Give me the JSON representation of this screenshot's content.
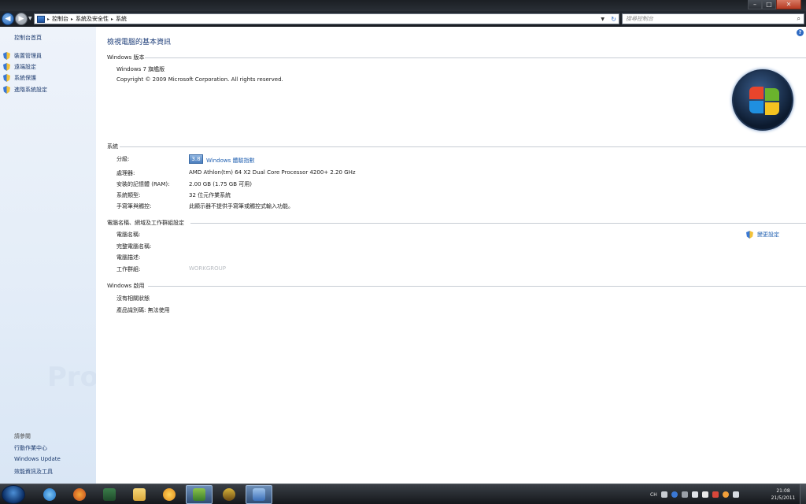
{
  "navigation": {
    "breadcrumbs": [
      "控制台",
      "系統及安全性",
      "系統"
    ],
    "search_placeholder": "搜尋控制台"
  },
  "left_pane": {
    "home_link": "控制台首頁",
    "tasks": [
      "裝置管理員",
      "遠端設定",
      "系統保護",
      "進階系統設定"
    ],
    "see_also_title": "請參閱",
    "see_also_links": [
      "行動作業中心",
      "Windows Update",
      "效能資訊及工具"
    ],
    "watermark": "Pro"
  },
  "main": {
    "title": "檢視電腦的基本資訊",
    "edition_section": {
      "heading": "Windows 版本",
      "edition": "Windows 7 旗艦版",
      "copyright": "Copyright © 2009 Microsoft Corporation.  All rights reserved."
    },
    "system_section": {
      "heading": "系統",
      "rating_label": "分級:",
      "rating_badge": "3.8",
      "rating_link": "Windows 體驗指數",
      "processor_label": "處理器:",
      "processor_value": "AMD Athlon(tm) 64 X2 Dual Core Processor 4200+   2.20 GHz",
      "ram_label": "安裝的記憶體 (RAM):",
      "ram_value": "2.00 GB (1.75 GB 可用)",
      "type_label": "系統類型:",
      "type_value": "32 位元作業系統",
      "pen_label": "手寫筆與觸控:",
      "pen_value": "此顯示器不提供手寫筆或觸控式輸入功能。"
    },
    "computer_section": {
      "heading": "電腦名稱、網域及工作群組設定",
      "computer_name_label": "電腦名稱:",
      "full_name_label": "完整電腦名稱:",
      "description_label": "電腦描述:",
      "workgroup_label": "工作群組:",
      "workgroup_value": "WORKGROUP",
      "change_settings": "變更設定"
    },
    "activation_section": {
      "heading": "Windows 啟用",
      "status": "沒有相關狀態",
      "product_id": "產品識別碼: 無法使用"
    }
  },
  "taskbar": {
    "tray_lang": "CH",
    "time": "21:08",
    "date": "21/5/2011"
  },
  "colors": {
    "accent_link": "#1f5fb0",
    "title_blue": "#1f3f7a",
    "left_pane_bg": "#e4edf8"
  }
}
